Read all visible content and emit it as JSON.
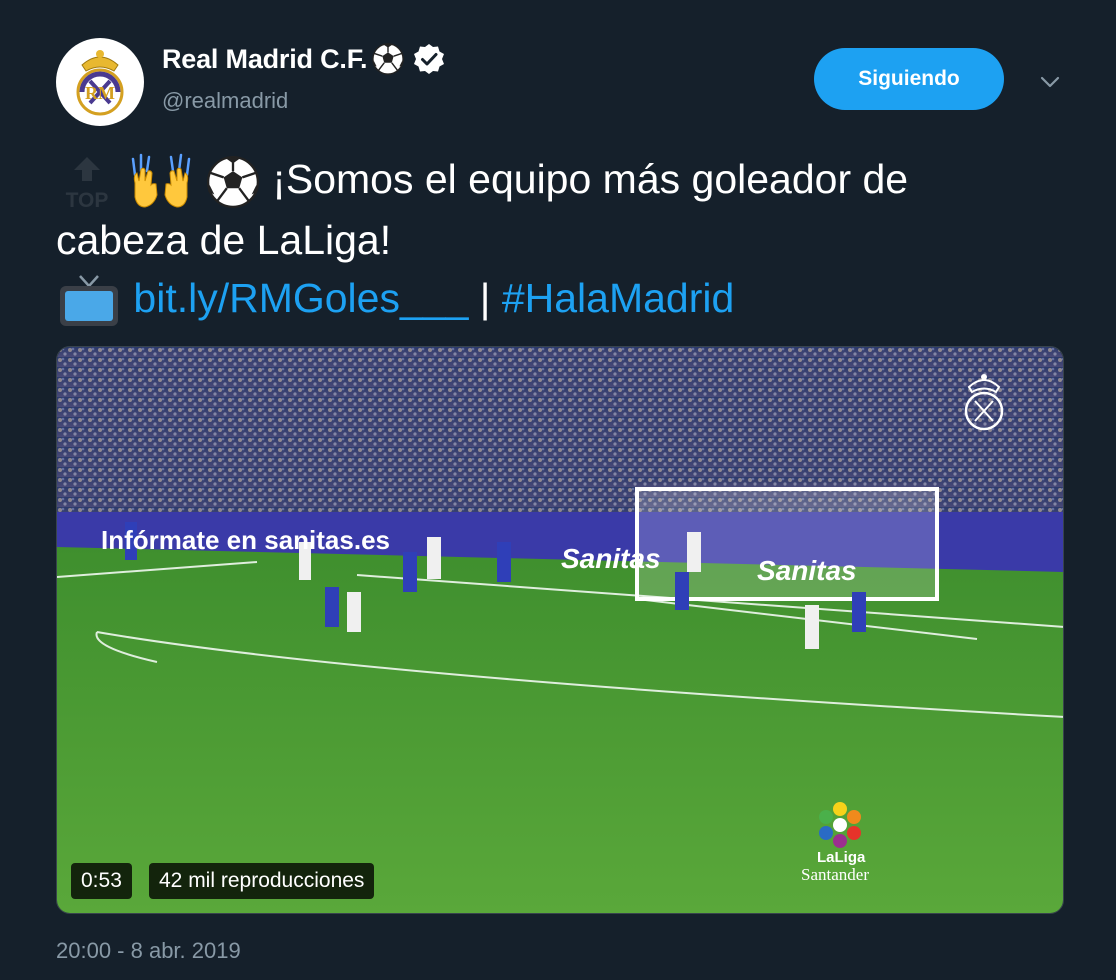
{
  "author": {
    "display_name": "Real Madrid C.F.",
    "handle": "@realmadrid",
    "avatar": "real-madrid-crest-icon",
    "name_emoji": "soccer-ball-icon",
    "verified_icon": "verified-badge-icon"
  },
  "follow_button": {
    "label": "Siguiendo"
  },
  "menu": {
    "icon": "chevron-down-icon"
  },
  "tweet": {
    "line1_text": "¡Somos el equipo más goleador de",
    "line2_text": "cabeza de LaLiga!",
    "emojis_line1": [
      "top-arrow-icon",
      "raising-hands-icon",
      "soccer-ball-icon"
    ],
    "emoji_line3": "television-icon",
    "link": "bit.ly/RMGoles___",
    "separator": "|",
    "hashtag": "#HalaMadrid"
  },
  "video": {
    "duration": "0:53",
    "views": "42 mil reproducciones",
    "ad_board_1": "Infórmate en sanitas.es",
    "ad_board_2": "Sanitas",
    "ad_board_3": "Sanitas",
    "watermark_logo": "laliga-santander-logo",
    "watermark_line1": "LaLiga",
    "watermark_line2": "Santander",
    "crest_watermark": "real-madrid-crest-icon"
  },
  "timestamp": "20:00 - 8 abr. 2019",
  "colors": {
    "background": "#15202b",
    "accent": "#1da1f2",
    "secondary_text": "#8899a6"
  }
}
